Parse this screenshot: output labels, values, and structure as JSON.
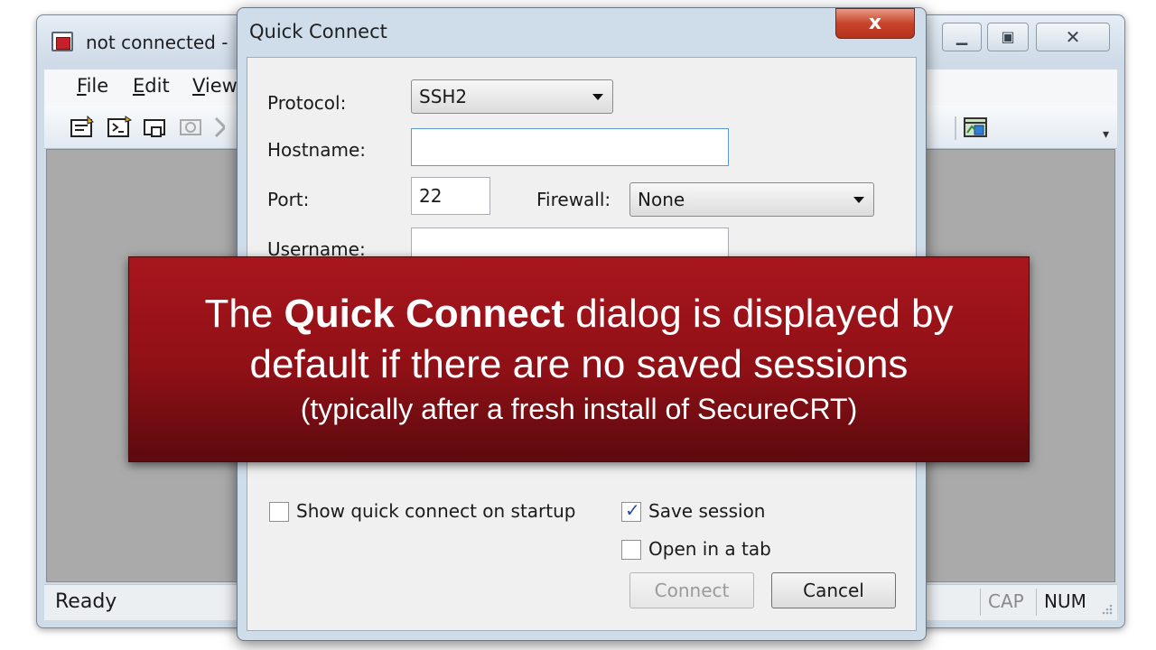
{
  "main_window": {
    "title": "not connected -",
    "controls": {
      "minimize_icon": "minimize-icon",
      "maximize_icon": "maximize-icon",
      "close_icon": "close-icon"
    },
    "menu": {
      "file": {
        "label": "File",
        "accel": "F",
        "rest": "ile"
      },
      "edit": {
        "label": "Edit",
        "accel": "E",
        "rest": "dit"
      },
      "view": {
        "label": "View",
        "accel": "V",
        "rest": "iew"
      }
    },
    "toolbar_icons": [
      "connect-icon",
      "quick-connect-icon",
      "connect-in-tab-icon",
      "reconnect-icon",
      "disconnect-icon",
      "session-options-icon"
    ],
    "status": {
      "text": "Ready",
      "cap": "CAP",
      "num": "NUM"
    }
  },
  "dialog": {
    "title": "Quick Connect",
    "close_glyph": "x",
    "protocol": {
      "label": "Protocol:",
      "value": "SSH2"
    },
    "hostname": {
      "label": "Hostname:",
      "value": ""
    },
    "port": {
      "label": "Port:",
      "value": "22"
    },
    "firewall": {
      "label": "Firewall:",
      "value": "None"
    },
    "username": {
      "label": "Username:",
      "value": ""
    },
    "show_on_startup": {
      "label": "Show quick connect on startup",
      "checked": false
    },
    "save_session": {
      "label": "Save session",
      "checked": true,
      "check_glyph": "✓"
    },
    "open_in_tab": {
      "label": "Open in a tab",
      "checked": false
    },
    "buttons": {
      "connect": "Connect",
      "cancel": "Cancel"
    }
  },
  "banner": {
    "line1_prefix": "The ",
    "line1_bold": "Quick Connect",
    "line1_suffix": " dialog is displayed by",
    "line2": "default if there are no saved sessions",
    "line3": "(typically after a fresh install of SecureCRT)",
    "color_top": "#a8161d",
    "color_bottom": "#5c0a0e"
  }
}
